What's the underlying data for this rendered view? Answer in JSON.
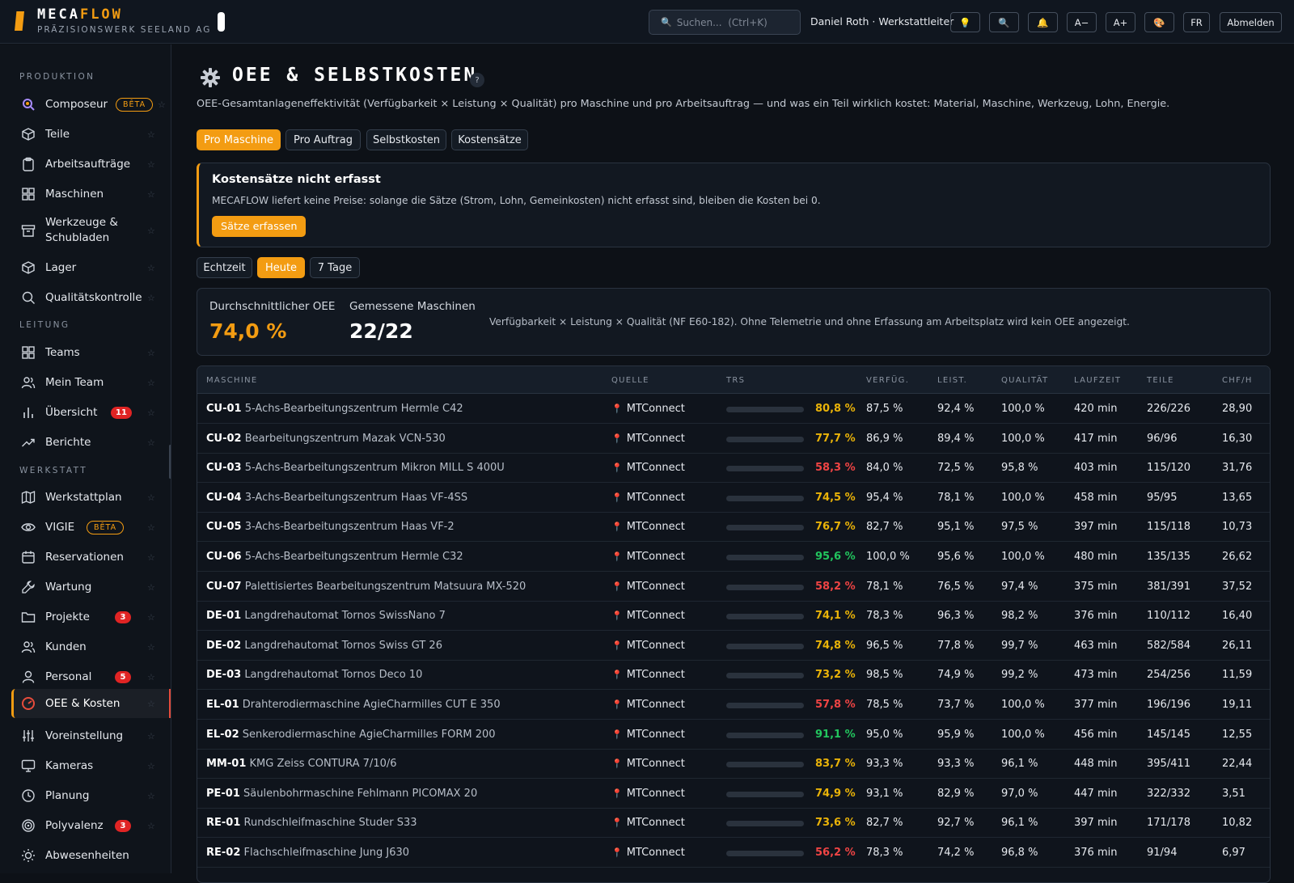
{
  "header": {
    "brand_part1": "MECA",
    "brand_part2": "FLOW",
    "company": "PRÄZISIONSWERK SEELAND AG",
    "search_placeholder": "Suchen...  (Ctrl+K)",
    "user": "Daniel Roth · Werkstattleiter",
    "buttons": {
      "idea": "💡",
      "search": "🔍",
      "bell": "🔔",
      "font_smaller": "A−",
      "font_larger": "A+",
      "theme": "🎨",
      "lang": "FR",
      "logout": "Abmelden"
    }
  },
  "sidebar": {
    "sections": {
      "production": "PRODUKTION",
      "management": "LEITUNG",
      "workshop": "WERKSTATT"
    },
    "items": [
      {
        "label": "Composeur",
        "badge": "BÊTA"
      },
      {
        "label": "Teile"
      },
      {
        "label": "Arbeitsaufträge"
      },
      {
        "label": "Maschinen"
      },
      {
        "label": "Werkzeuge & Schubladen"
      },
      {
        "label": "Lager"
      },
      {
        "label": "Qualitätskontrolle"
      },
      {
        "label": "Teams"
      },
      {
        "label": "Mein Team"
      },
      {
        "label": "Übersicht",
        "badge": "11"
      },
      {
        "label": "Berichte"
      },
      {
        "label": "Werkstattplan"
      },
      {
        "label": "VIGIE",
        "badge": "BÊTA"
      },
      {
        "label": "Reservationen"
      },
      {
        "label": "Wartung"
      },
      {
        "label": "Projekte",
        "badge": "3"
      },
      {
        "label": "Kunden"
      },
      {
        "label": "Personal",
        "badge": "5"
      },
      {
        "label": "OEE & Kosten"
      },
      {
        "label": "Voreinstellung"
      },
      {
        "label": "Kameras"
      },
      {
        "label": "Planung"
      },
      {
        "label": "Polyvalenz",
        "badge": "3"
      },
      {
        "label": "Abwesenheiten"
      }
    ],
    "star": "☆"
  },
  "page": {
    "title": "OEE & SELBSTKOSTEN",
    "help": "?",
    "subtitle": "OEE-Gesamtanlageneffektivität (Verfügbarkeit × Leistung × Qualität) pro Maschine und pro Arbeitsauftrag — und was ein Teil wirklich kostet: Material, Maschine, Werkzeug, Lohn, Energie.",
    "tabs": [
      "Pro Maschine",
      "Pro Auftrag",
      "Selbstkosten",
      "Kostensätze"
    ],
    "active_tab": "Pro Maschine",
    "alert": {
      "title": "Kostensätze nicht erfasst",
      "message": "MECAFLOW liefert keine Preise: solange die Sätze (Strom, Lohn, Gemeinkosten) nicht erfasst sind, bleiben die Kosten bei 0.",
      "button": "Sätze erfassen"
    },
    "periods": [
      "Echtzeit",
      "Heute",
      "7 Tage"
    ],
    "active_period": "Heute",
    "kpi": {
      "avg_oee_label": "Durchschnittlicher OEE",
      "avg_oee_value": "74,0 %",
      "measured_label": "Gemessene Maschinen",
      "measured_value": "22/22",
      "note": "Verfügbarkeit × Leistung × Qualität (NF E60-182). Ohne Telemetrie und ohne Erfassung am Arbeitsplatz wird kein OEE angezeigt."
    }
  },
  "table": {
    "headers": [
      "MASCHINE",
      "QUELLE",
      "TRS",
      "VERFÜG.",
      "LEIST.",
      "QUALITÄT",
      "LAUFZEIT",
      "TEILE",
      "CHF/H"
    ],
    "source_icon": "📍",
    "colors": {
      "good": "#22c55e",
      "mid": "#eab308",
      "bad": "#ef4444"
    },
    "rows": [
      {
        "id": "CU-01",
        "name": "5-Achs-Bearbeitungszentrum Hermle C42",
        "source": "MTConnect",
        "trs": 80.8,
        "trs_text": "80,8 %",
        "status": "mid",
        "avail": "87,5 %",
        "perf": "92,4 %",
        "qual": "100,0 %",
        "runtime": "420 min",
        "parts": "226/226",
        "chf": "28,90"
      },
      {
        "id": "CU-02",
        "name": "Bearbeitungszentrum Mazak VCN-530",
        "source": "MTConnect",
        "trs": 77.7,
        "trs_text": "77,7 %",
        "status": "mid",
        "avail": "86,9 %",
        "perf": "89,4 %",
        "qual": "100,0 %",
        "runtime": "417 min",
        "parts": "96/96",
        "chf": "16,30"
      },
      {
        "id": "CU-03",
        "name": "5-Achs-Bearbeitungszentrum Mikron MILL S 400U",
        "source": "MTConnect",
        "trs": 58.3,
        "trs_text": "58,3 %",
        "status": "bad",
        "avail": "84,0 %",
        "perf": "72,5 %",
        "qual": "95,8 %",
        "runtime": "403 min",
        "parts": "115/120",
        "chf": "31,76"
      },
      {
        "id": "CU-04",
        "name": "3-Achs-Bearbeitungszentrum Haas VF-4SS",
        "source": "MTConnect",
        "trs": 74.5,
        "trs_text": "74,5 %",
        "status": "mid",
        "avail": "95,4 %",
        "perf": "78,1 %",
        "qual": "100,0 %",
        "runtime": "458 min",
        "parts": "95/95",
        "chf": "13,65"
      },
      {
        "id": "CU-05",
        "name": "3-Achs-Bearbeitungszentrum Haas VF-2",
        "source": "MTConnect",
        "trs": 76.7,
        "trs_text": "76,7 %",
        "status": "mid",
        "avail": "82,7 %",
        "perf": "95,1 %",
        "qual": "97,5 %",
        "runtime": "397 min",
        "parts": "115/118",
        "chf": "10,73"
      },
      {
        "id": "CU-06",
        "name": "5-Achs-Bearbeitungszentrum Hermle C32",
        "source": "MTConnect",
        "trs": 95.6,
        "trs_text": "95,6 %",
        "status": "good",
        "avail": "100,0 %",
        "perf": "95,6 %",
        "qual": "100,0 %",
        "runtime": "480 min",
        "parts": "135/135",
        "chf": "26,62"
      },
      {
        "id": "CU-07",
        "name": "Palettisiertes Bearbeitungszentrum Matsuura MX-520",
        "source": "MTConnect",
        "trs": 58.2,
        "trs_text": "58,2 %",
        "status": "bad",
        "avail": "78,1 %",
        "perf": "76,5 %",
        "qual": "97,4 %",
        "runtime": "375 min",
        "parts": "381/391",
        "chf": "37,52"
      },
      {
        "id": "DE-01",
        "name": "Langdrehautomat Tornos SwissNano 7",
        "source": "MTConnect",
        "trs": 74.1,
        "trs_text": "74,1 %",
        "status": "mid",
        "avail": "78,3 %",
        "perf": "96,3 %",
        "qual": "98,2 %",
        "runtime": "376 min",
        "parts": "110/112",
        "chf": "16,40"
      },
      {
        "id": "DE-02",
        "name": "Langdrehautomat Tornos Swiss GT 26",
        "source": "MTConnect",
        "trs": 74.8,
        "trs_text": "74,8 %",
        "status": "mid",
        "avail": "96,5 %",
        "perf": "77,8 %",
        "qual": "99,7 %",
        "runtime": "463 min",
        "parts": "582/584",
        "chf": "26,11"
      },
      {
        "id": "DE-03",
        "name": "Langdrehautomat Tornos Deco 10",
        "source": "MTConnect",
        "trs": 73.2,
        "trs_text": "73,2 %",
        "status": "mid",
        "avail": "98,5 %",
        "perf": "74,9 %",
        "qual": "99,2 %",
        "runtime": "473 min",
        "parts": "254/256",
        "chf": "11,59"
      },
      {
        "id": "EL-01",
        "name": "Drahterodiermaschine AgieCharmilles CUT E 350",
        "source": "MTConnect",
        "trs": 57.8,
        "trs_text": "57,8 %",
        "status": "bad",
        "avail": "78,5 %",
        "perf": "73,7 %",
        "qual": "100,0 %",
        "runtime": "377 min",
        "parts": "196/196",
        "chf": "19,11"
      },
      {
        "id": "EL-02",
        "name": "Senkerodiermaschine AgieCharmilles FORM 200",
        "source": "MTConnect",
        "trs": 91.1,
        "trs_text": "91,1 %",
        "status": "good",
        "avail": "95,0 %",
        "perf": "95,9 %",
        "qual": "100,0 %",
        "runtime": "456 min",
        "parts": "145/145",
        "chf": "12,55"
      },
      {
        "id": "MM-01",
        "name": "KMG Zeiss CONTURA 7/10/6",
        "source": "MTConnect",
        "trs": 83.7,
        "trs_text": "83,7 %",
        "status": "mid",
        "avail": "93,3 %",
        "perf": "93,3 %",
        "qual": "96,1 %",
        "runtime": "448 min",
        "parts": "395/411",
        "chf": "22,44"
      },
      {
        "id": "PE-01",
        "name": "Säulenbohrmaschine Fehlmann PICOMAX 20",
        "source": "MTConnect",
        "trs": 74.9,
        "trs_text": "74,9 %",
        "status": "mid",
        "avail": "93,1 %",
        "perf": "82,9 %",
        "qual": "97,0 %",
        "runtime": "447 min",
        "parts": "322/332",
        "chf": "3,51"
      },
      {
        "id": "RE-01",
        "name": "Rundschleifmaschine Studer S33",
        "source": "MTConnect",
        "trs": 73.6,
        "trs_text": "73,6 %",
        "status": "mid",
        "avail": "82,7 %",
        "perf": "92,7 %",
        "qual": "96,1 %",
        "runtime": "397 min",
        "parts": "171/178",
        "chf": "10,82"
      },
      {
        "id": "RE-02",
        "name": "Flachschleifmaschine Jung J630",
        "source": "MTConnect",
        "trs": 56.2,
        "trs_text": "56,2 %",
        "status": "bad",
        "avail": "78,3 %",
        "perf": "74,2 %",
        "qual": "96,8 %",
        "runtime": "376 min",
        "parts": "91/94",
        "chf": "6,97"
      }
    ]
  }
}
